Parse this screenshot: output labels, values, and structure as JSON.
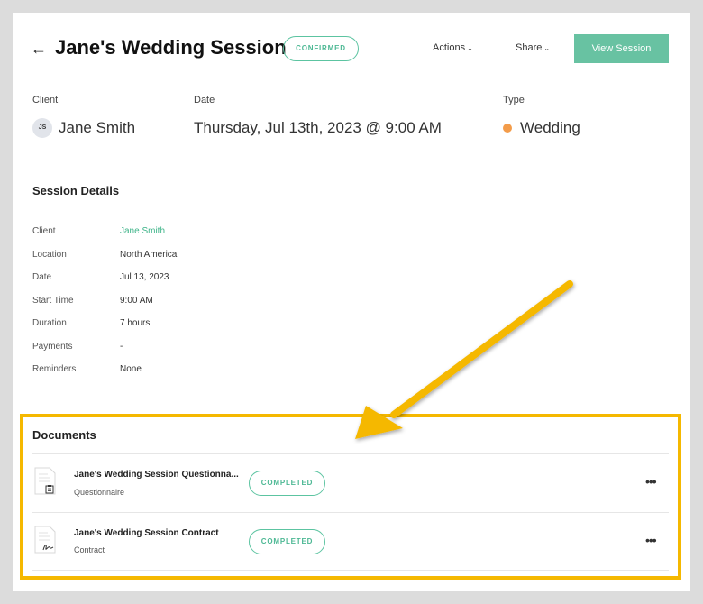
{
  "header": {
    "title": "Jane's Wedding Session",
    "status": "CONFIRMED",
    "actions_label": "Actions",
    "share_label": "Share",
    "view_session_label": "View Session"
  },
  "summary": {
    "client_label": "Client",
    "client_initials": "JS",
    "client_name": "Jane Smith",
    "date_label": "Date",
    "date_value": "Thursday, Jul 13th, 2023 @ 9:00 AM",
    "type_label": "Type",
    "type_value": "Wedding",
    "type_color": "#f39c4a"
  },
  "details": {
    "title": "Session Details",
    "rows": [
      {
        "label": "Client",
        "value": "Jane Smith"
      },
      {
        "label": "Location",
        "value": "North America"
      },
      {
        "label": "Date",
        "value": "Jul 13, 2023"
      },
      {
        "label": "Start Time",
        "value": "9:00 AM"
      },
      {
        "label": "Duration",
        "value": "7 hours"
      },
      {
        "label": "Payments",
        "value": "-"
      },
      {
        "label": "Reminders",
        "value": "None"
      }
    ]
  },
  "documents": {
    "title": "Documents",
    "items": [
      {
        "title": "Jane's Wedding Session Questionna...",
        "type": "Questionnaire",
        "status": "COMPLETED",
        "icon": "questionnaire-icon"
      },
      {
        "title": "Jane's Wedding Session Contract",
        "type": "Contract",
        "status": "COMPLETED",
        "icon": "contract-icon"
      }
    ]
  },
  "colors": {
    "accent": "#68c2a2",
    "highlight": "#f5b800"
  }
}
